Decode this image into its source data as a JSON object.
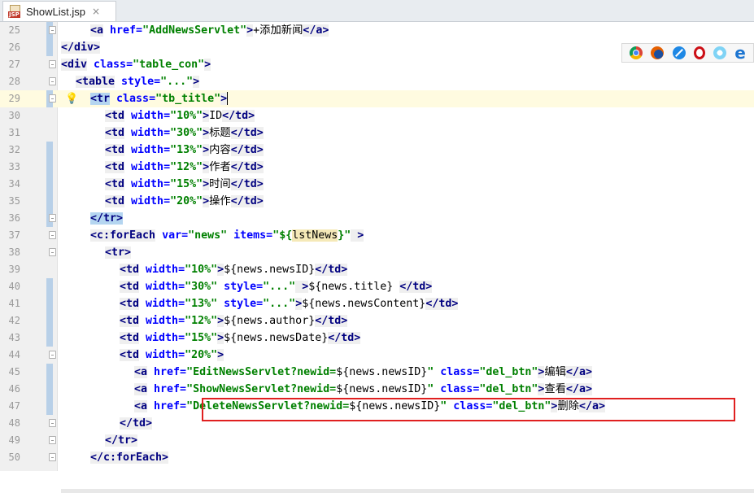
{
  "tab": {
    "title": "ShowList.jsp",
    "icon": "jsp-file-icon",
    "close": "×",
    "icon_text": "JSP"
  },
  "browsers": [
    "chrome-icon",
    "firefox-icon",
    "safari-icon",
    "opera-icon",
    "ie9-icon",
    "edge-icon"
  ],
  "lines": [
    {
      "n": "25",
      "indent": 4,
      "segs": [
        [
          "t",
          "<a"
        ],
        [
          "a",
          " href="
        ],
        [
          "v",
          "\"AddNewsServlet\""
        ],
        [
          "t",
          ">"
        ],
        [
          "txt",
          "+添加新闻"
        ],
        [
          "t",
          "</a>"
        ]
      ]
    },
    {
      "n": "26",
      "indent": 0,
      "segs": [
        [
          "t",
          "</div>"
        ]
      ]
    },
    {
      "n": "27",
      "indent": 0,
      "segs": [
        [
          "t",
          "<div"
        ],
        [
          "a",
          " class="
        ],
        [
          "v",
          "\"table_con\""
        ],
        [
          "t",
          ">"
        ]
      ]
    },
    {
      "n": "28",
      "indent": 2,
      "segs": [
        [
          "t",
          "<table"
        ],
        [
          "a",
          " style="
        ],
        [
          "v",
          "\"...\""
        ],
        [
          "t",
          ">"
        ]
      ]
    },
    {
      "n": "29",
      "indent": 4,
      "segs": [
        [
          "th",
          "<tr"
        ],
        [
          "a",
          " class="
        ],
        [
          "v",
          "\"tb_title\""
        ],
        [
          "t",
          ">"
        ]
      ]
    },
    {
      "n": "30",
      "indent": 6,
      "segs": [
        [
          "t",
          "<td"
        ],
        [
          "a",
          " width="
        ],
        [
          "v",
          "\"10%\""
        ],
        [
          "t",
          ">"
        ],
        [
          "txt",
          "ID"
        ],
        [
          "t",
          "</td>"
        ]
      ]
    },
    {
      "n": "31",
      "indent": 6,
      "segs": [
        [
          "t",
          "<td"
        ],
        [
          "a",
          " width="
        ],
        [
          "v",
          "\"30%\""
        ],
        [
          "t",
          ">"
        ],
        [
          "txt",
          "标题"
        ],
        [
          "t",
          "</td>"
        ]
      ]
    },
    {
      "n": "32",
      "indent": 6,
      "segs": [
        [
          "t",
          "<td"
        ],
        [
          "a",
          " width="
        ],
        [
          "v",
          "\"13%\""
        ],
        [
          "t",
          ">"
        ],
        [
          "txt",
          "内容"
        ],
        [
          "t",
          "</td>"
        ]
      ]
    },
    {
      "n": "33",
      "indent": 6,
      "segs": [
        [
          "t",
          "<td"
        ],
        [
          "a",
          " width="
        ],
        [
          "v",
          "\"12%\""
        ],
        [
          "t",
          ">"
        ],
        [
          "txt",
          "作者"
        ],
        [
          "t",
          "</td>"
        ]
      ]
    },
    {
      "n": "34",
      "indent": 6,
      "segs": [
        [
          "t",
          "<td"
        ],
        [
          "a",
          " width="
        ],
        [
          "v",
          "\"15%\""
        ],
        [
          "t",
          ">"
        ],
        [
          "txt",
          "时间"
        ],
        [
          "t",
          "</td>"
        ]
      ]
    },
    {
      "n": "35",
      "indent": 6,
      "segs": [
        [
          "t",
          "<td"
        ],
        [
          "a",
          " width="
        ],
        [
          "v",
          "\"20%\""
        ],
        [
          "t",
          ">"
        ],
        [
          "txt",
          "操作"
        ],
        [
          "t",
          "</td>"
        ]
      ]
    },
    {
      "n": "36",
      "indent": 4,
      "segs": [
        [
          "th",
          "</tr>"
        ]
      ]
    },
    {
      "n": "37",
      "indent": 4,
      "segs": [
        [
          "t",
          "<c:forEach"
        ],
        [
          "a",
          " var="
        ],
        [
          "v",
          "\"news\""
        ],
        [
          "a",
          " items="
        ],
        [
          "v",
          "\"${"
        ],
        [
          "elh",
          "lstNews"
        ],
        [
          "v",
          "}\""
        ],
        [
          "t",
          " >"
        ]
      ]
    },
    {
      "n": "38",
      "indent": 6,
      "segs": [
        [
          "t",
          "<tr>"
        ]
      ]
    },
    {
      "n": "39",
      "indent": 8,
      "segs": [
        [
          "t",
          "<td"
        ],
        [
          "a",
          " width="
        ],
        [
          "v",
          "\"10%\""
        ],
        [
          "t",
          ">"
        ],
        [
          "el",
          "${news.newsID}"
        ],
        [
          "t",
          "</td>"
        ]
      ]
    },
    {
      "n": "40",
      "indent": 8,
      "segs": [
        [
          "t",
          "<td"
        ],
        [
          "a",
          " width="
        ],
        [
          "v",
          "\"30%\""
        ],
        [
          "a",
          " style="
        ],
        [
          "v",
          "\"...\""
        ],
        [
          "t",
          " >"
        ],
        [
          "el",
          "${news.title} "
        ],
        [
          "t",
          "</td>"
        ]
      ]
    },
    {
      "n": "41",
      "indent": 8,
      "segs": [
        [
          "t",
          "<td"
        ],
        [
          "a",
          " width="
        ],
        [
          "v",
          "\"13%\""
        ],
        [
          "a",
          " style="
        ],
        [
          "v",
          "\"...\""
        ],
        [
          "t",
          ">"
        ],
        [
          "el",
          "${news.newsContent}"
        ],
        [
          "t",
          "</td>"
        ]
      ]
    },
    {
      "n": "42",
      "indent": 8,
      "segs": [
        [
          "t",
          "<td"
        ],
        [
          "a",
          " width="
        ],
        [
          "v",
          "\"12%\""
        ],
        [
          "t",
          ">"
        ],
        [
          "el",
          "${news.author}"
        ],
        [
          "t",
          "</td>"
        ]
      ]
    },
    {
      "n": "43",
      "indent": 8,
      "segs": [
        [
          "t",
          "<td"
        ],
        [
          "a",
          " width="
        ],
        [
          "v",
          "\"15%\""
        ],
        [
          "t",
          ">"
        ],
        [
          "el",
          "${news.newsDate}"
        ],
        [
          "t",
          "</td>"
        ]
      ]
    },
    {
      "n": "44",
      "indent": 8,
      "segs": [
        [
          "t",
          "<td"
        ],
        [
          "a",
          " width="
        ],
        [
          "v",
          "\"20%\""
        ],
        [
          "t",
          ">"
        ]
      ]
    },
    {
      "n": "45",
      "indent": 10,
      "segs": [
        [
          "t",
          "<a"
        ],
        [
          "a",
          " href="
        ],
        [
          "v",
          "\"EditNewsServlet?newid="
        ],
        [
          "el",
          "${news.newsID}"
        ],
        [
          "v",
          "\""
        ],
        [
          "a",
          " class="
        ],
        [
          "v",
          "\"del_btn\""
        ],
        [
          "t",
          ">"
        ],
        [
          "txt",
          "编辑"
        ],
        [
          "t",
          "</a>"
        ]
      ]
    },
    {
      "n": "46",
      "indent": 10,
      "segs": [
        [
          "t",
          "<a"
        ],
        [
          "a",
          " href="
        ],
        [
          "v",
          "\"ShowNewsServlet?newid="
        ],
        [
          "el",
          "${news.newsID}"
        ],
        [
          "v",
          "\""
        ],
        [
          "a",
          " class="
        ],
        [
          "v",
          "\"del_btn\""
        ],
        [
          "t",
          ">"
        ],
        [
          "txt",
          "查看"
        ],
        [
          "t",
          "</a>"
        ]
      ]
    },
    {
      "n": "47",
      "indent": 10,
      "segs": [
        [
          "t",
          "<a"
        ],
        [
          "a",
          " href="
        ],
        [
          "v",
          "\"DeleteNewsServlet?newid="
        ],
        [
          "el",
          "${news.newsID}"
        ],
        [
          "v",
          "\""
        ],
        [
          "a",
          " class="
        ],
        [
          "v",
          "\"del_btn\""
        ],
        [
          "t",
          ">"
        ],
        [
          "txt",
          "删除"
        ],
        [
          "t",
          "</a>"
        ]
      ]
    },
    {
      "n": "48",
      "indent": 8,
      "segs": [
        [
          "t",
          "</td>"
        ]
      ]
    },
    {
      "n": "49",
      "indent": 6,
      "segs": [
        [
          "t",
          "</tr>"
        ]
      ]
    },
    {
      "n": "50",
      "indent": 4,
      "segs": [
        [
          "t",
          "</c:forEach>"
        ]
      ]
    }
  ],
  "current_line": "29",
  "modified_lines": [
    "25",
    "26",
    "29",
    "32",
    "33",
    "34",
    "35",
    "36",
    "40",
    "41",
    "42",
    "43",
    "45",
    "46",
    "47"
  ],
  "fold_lines": [
    "25",
    "27",
    "28",
    "29",
    "36",
    "37",
    "38",
    "44",
    "48",
    "49",
    "50"
  ],
  "highlighted_line": "47"
}
